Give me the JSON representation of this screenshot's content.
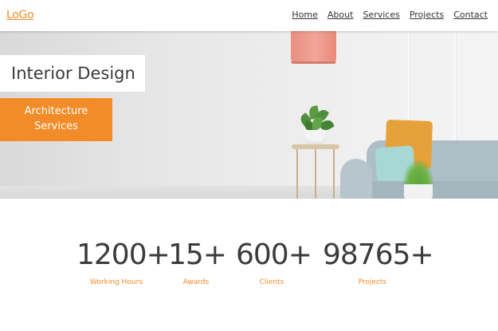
{
  "nav": {
    "logo": "LoGo",
    "links": [
      "Home",
      "About",
      "Services",
      "Projects",
      "Contact"
    ]
  },
  "hero": {
    "title": "Interior Design",
    "subtitle_line1": "Architecture",
    "subtitle_line2": "Services"
  },
  "stats": [
    {
      "value": "1200+",
      "label": "Working Hours"
    },
    {
      "value": "15+",
      "label": "Awards"
    },
    {
      "value": "600+",
      "label": "Clients"
    },
    {
      "value": "98765+",
      "label": "Projects"
    }
  ],
  "colors": {
    "accent": "#f28c28",
    "text": "#3b3b3b",
    "background": "#ffffff"
  }
}
